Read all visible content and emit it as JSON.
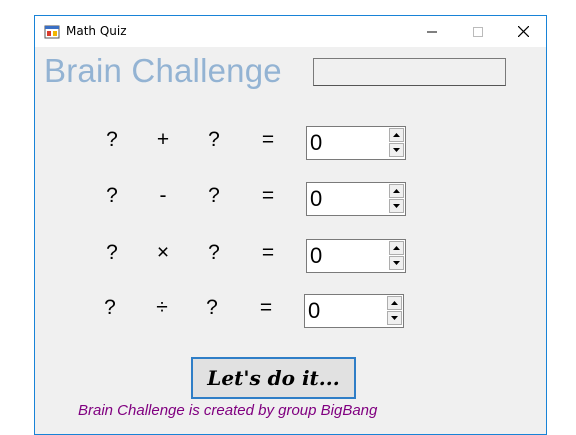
{
  "window": {
    "title": "Math Quiz"
  },
  "heading": "Brain Challenge",
  "name_box": {
    "value": ""
  },
  "equations": [
    {
      "left": "?",
      "operator": "+",
      "right": "?",
      "equals": "=",
      "answer": "0"
    },
    {
      "left": "?",
      "operator": "-",
      "right": "?",
      "equals": "=",
      "answer": "0"
    },
    {
      "left": "?",
      "operator": "×",
      "right": "?",
      "equals": "=",
      "answer": "0"
    },
    {
      "left": "?",
      "operator": "÷",
      "right": "?",
      "equals": "=",
      "answer": "0"
    }
  ],
  "start_button": {
    "label": "Let's do it..."
  },
  "credit": "Brain Challenge is created by group BigBang",
  "colors": {
    "heading": "#93b3d3",
    "credit": "#800080",
    "accent": "#1883d7"
  }
}
